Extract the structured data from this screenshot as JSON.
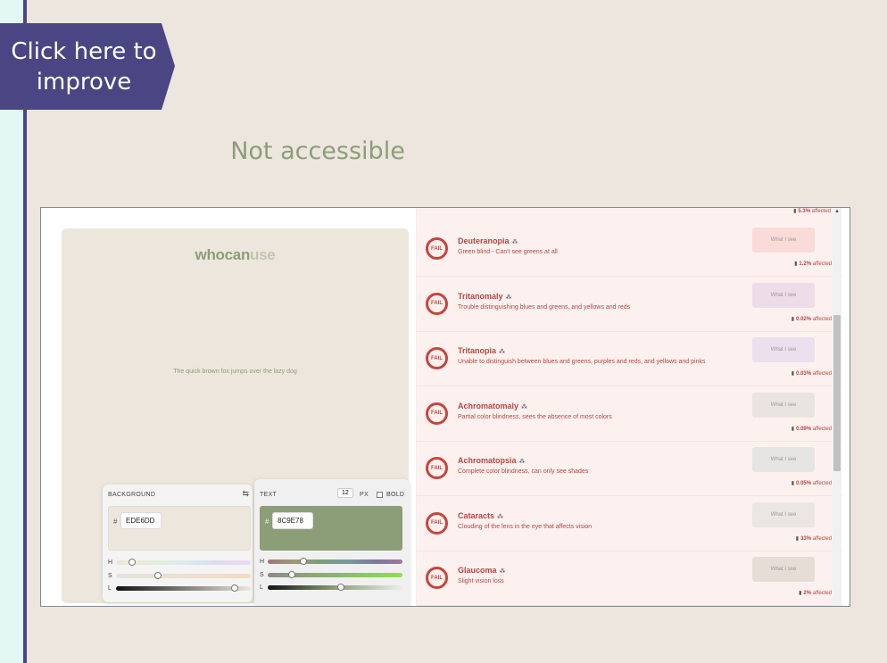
{
  "badge": {
    "line1": "Click here to",
    "line2": "improve"
  },
  "slide": {
    "title": "Not accessible"
  },
  "app": {
    "logo_main": "whocan",
    "logo_faded": "use",
    "sample_text": "The quick brown fox jumps over the lazy dog",
    "background": {
      "label": "BACKGROUND",
      "hash": "#",
      "hex": "EDE6DD",
      "color": "#ede6dd"
    },
    "text": {
      "label": "TEXT",
      "size": "12",
      "size_unit": "PX",
      "bold_label": "BOLD",
      "hash": "#",
      "hex": "8C9E78",
      "color": "#8c9e78"
    },
    "slider_labels": {
      "h": "H",
      "s": "S",
      "l": "L"
    },
    "top_affected": {
      "value": "5.3%",
      "suffix": "affected"
    },
    "what_i_see": "What I see",
    "fail_label": "FAIL",
    "rows": [
      {
        "title": "Deuteranopia",
        "desc": "Green blind - Can't see greens at all",
        "value": "1.2%",
        "suffix": "affected",
        "see_color": "#f9dcd9"
      },
      {
        "title": "Tritanomaly",
        "desc": "Trouble distinguishing blues and greens, and yellows and reds",
        "value": "0.02%",
        "suffix": "affected",
        "see_color": "#eedde8"
      },
      {
        "title": "Tritanopia",
        "desc": "Unable to distinguish between blues and greens, purples and reds, and yellows and pinks",
        "value": "0.03%",
        "suffix": "affected",
        "see_color": "#ece0ee"
      },
      {
        "title": "Achromatomaly",
        "desc": "Partial color blindness, sees the absence of most colors",
        "value": "0.09%",
        "suffix": "affected",
        "see_color": "#e9e4e1"
      },
      {
        "title": "Achromatopsia",
        "desc": "Complete color blindness, can only see shades",
        "value": "0.05%",
        "suffix": "affected",
        "see_color": "#e7e5e4"
      },
      {
        "title": "Cataracts",
        "desc": "Clouding of the lens in the eye that affects vision",
        "value": "33%",
        "suffix": "affected",
        "see_color": "#ebe6e2"
      },
      {
        "title": "Glaucoma",
        "desc": "Slight vision loss",
        "value": "2%",
        "suffix": "affected",
        "see_color": "#e6ddd6"
      }
    ]
  }
}
